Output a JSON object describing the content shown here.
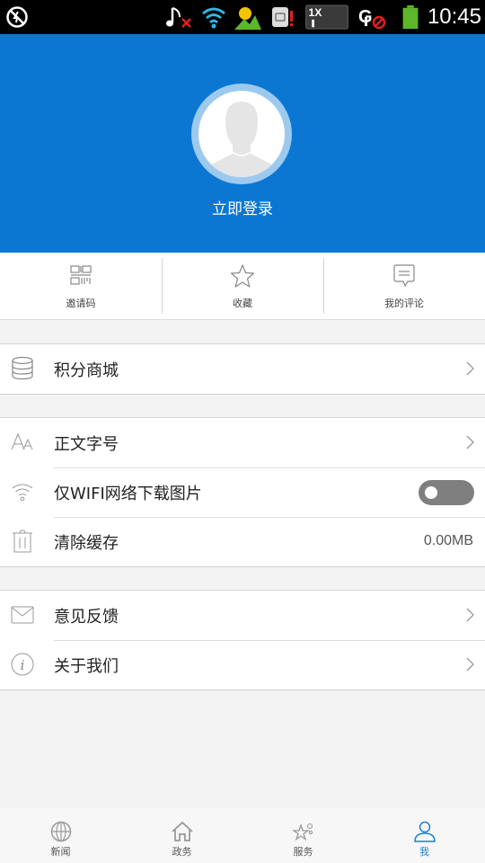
{
  "statusbar": {
    "time": "10:45",
    "icons": [
      "no-data-icon",
      "music-muted-icon",
      "wifi-icon",
      "weather-icon",
      "sim-alert-icon",
      "network-1x-icon",
      "gps-disabled-icon",
      "battery-icon"
    ]
  },
  "header": {
    "login_label": "立即登录",
    "accent_color": "#0b77d3"
  },
  "quick_actions": [
    {
      "label": "邀请码",
      "icon": "qr-code-icon"
    },
    {
      "label": "收藏",
      "icon": "star-icon"
    },
    {
      "label": "我的评论",
      "icon": "comment-icon"
    }
  ],
  "groups": [
    {
      "items": [
        {
          "label": "积分商城",
          "icon": "database-icon",
          "accessory": "chevron"
        }
      ]
    },
    {
      "items": [
        {
          "label": "正文字号",
          "icon": "font-size-icon",
          "accessory": "chevron"
        },
        {
          "label": "仅WIFI网络下载图片",
          "icon": "wifi-icon",
          "accessory": "toggle",
          "toggle_on": false
        },
        {
          "label": "清除缓存",
          "icon": "trash-icon",
          "accessory": "value",
          "value": "0.00MB"
        }
      ]
    },
    {
      "items": [
        {
          "label": "意见反馈",
          "icon": "mail-icon",
          "accessory": "chevron"
        },
        {
          "label": "关于我们",
          "icon": "info-icon",
          "accessory": "chevron"
        }
      ]
    }
  ],
  "bottom_nav": [
    {
      "label": "新闻",
      "icon": "globe-icon",
      "active": false
    },
    {
      "label": "政务",
      "icon": "home-icon",
      "active": false
    },
    {
      "label": "服务",
      "icon": "services-icon",
      "active": false
    },
    {
      "label": "我",
      "icon": "user-icon",
      "active": true
    }
  ]
}
